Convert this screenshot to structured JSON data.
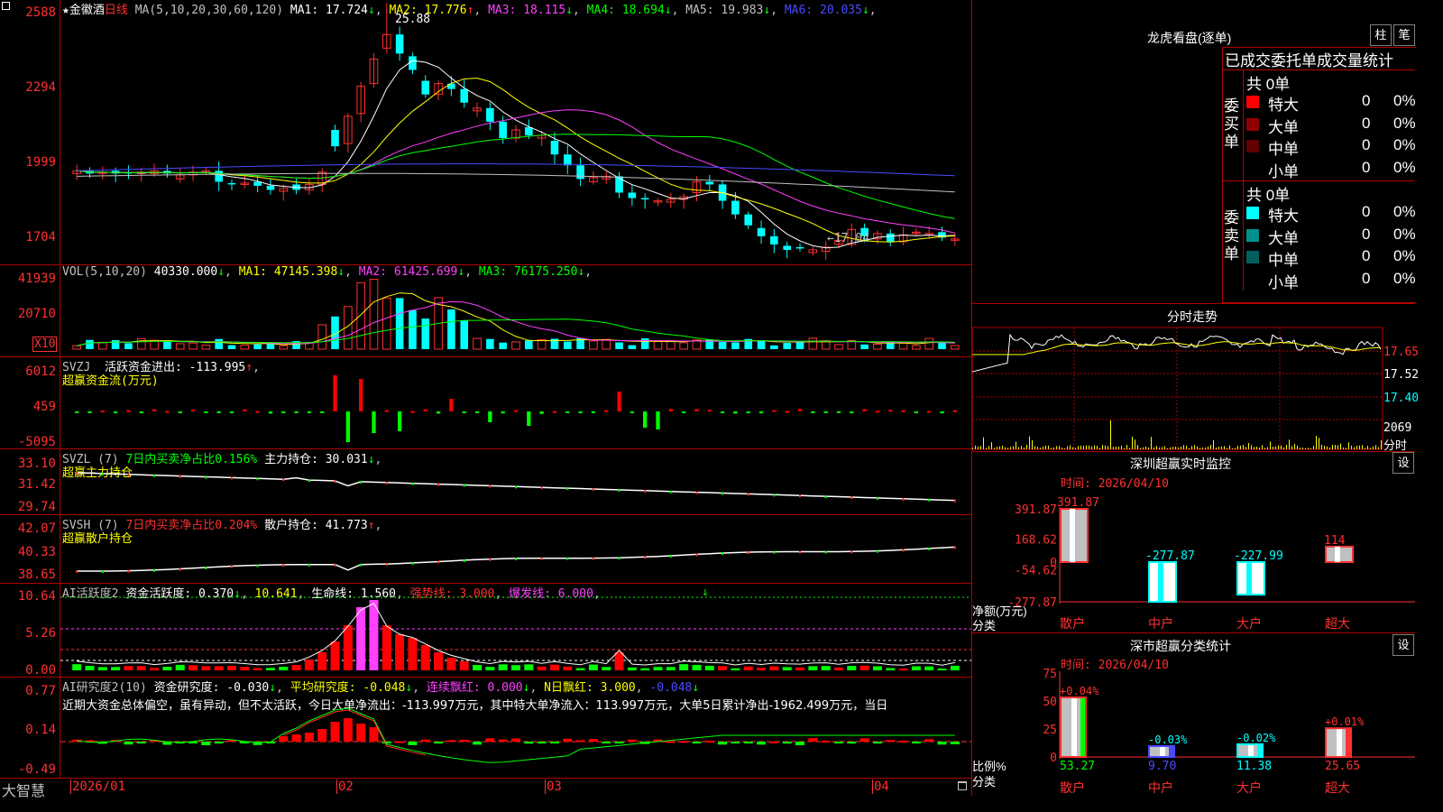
{
  "stock": {
    "name": "金徽酒",
    "period": "日线",
    "star": "★"
  },
  "price_pane": {
    "ma_title": "MA(5,10,20,30,60,120)",
    "ma": [
      {
        "label": "MA1:",
        "value": "17.724",
        "dir": "↓",
        "color": "#ffffff"
      },
      {
        "label": "MA2:",
        "value": "17.776",
        "dir": "↑",
        "color": "#ffff00"
      },
      {
        "label": "MA3:",
        "value": "18.115",
        "dir": "↓",
        "color": "#ff40ff"
      },
      {
        "label": "MA4:",
        "value": "18.694",
        "dir": "↓",
        "color": "#00ff00"
      },
      {
        "label": "MA5:",
        "value": "19.983",
        "dir": "↓",
        "color": "#c0c0c0"
      },
      {
        "label": "MA6:",
        "value": "20.035",
        "dir": "↓",
        "color": "#4a4aff"
      }
    ],
    "y_labels": [
      "2588",
      "2294",
      "1999",
      "1704"
    ],
    "high_label": "25.88",
    "low_label": "←17.04"
  },
  "vol_pane": {
    "title": "VOL(5,10,20)",
    "value": "40330.000",
    "dir": "↓",
    "ma": [
      {
        "label": "MA1:",
        "value": "47145.398",
        "dir": "↓",
        "color": "#ffff00"
      },
      {
        "label": "MA2:",
        "value": "61425.699",
        "dir": "↓",
        "color": "#ff40ff"
      },
      {
        "label": "MA3:",
        "value": "76175.250",
        "dir": "↓",
        "color": "#00ff00"
      }
    ],
    "y_labels": [
      "41939",
      "20710"
    ],
    "unit": "X10"
  },
  "svzj_pane": {
    "title": "SVZJ",
    "label": "活跃资金进出:",
    "value": "-113.995",
    "dir": "↑",
    "sub": "超赢资金流(万元)",
    "y_labels": [
      "6012",
      "459",
      "-5095"
    ]
  },
  "svzl_pane": {
    "title": "SVZL (7)",
    "ratio_label": "7日内买卖净占比0.156%",
    "hold_label": "主力持仓:",
    "hold_value": "30.031",
    "dir": "↓",
    "sub": "超赢主力持仓",
    "y_labels": [
      "33.10",
      "31.42",
      "29.74"
    ]
  },
  "svsh_pane": {
    "title": "SVSH (7)",
    "ratio_label": "7日内买卖净占比0.204%",
    "hold_label": "散户持仓:",
    "hold_value": "41.773",
    "dir": "↑",
    "sub": "超赢散户持仓",
    "y_labels": [
      "42.07",
      "40.33",
      "38.65"
    ]
  },
  "ai_active_pane": {
    "title": "AI活跃度2",
    "label": "资金活跃度:",
    "value": "0.370",
    "dir": "↓",
    "v2": "10.641",
    "life_label": "生命线:",
    "life_value": "1.560",
    "strong": "强势线: 3.000",
    "burst": "爆发线: 6.000",
    "y_labels": [
      "10.64",
      "5.26",
      "0.00"
    ]
  },
  "ai_research_pane": {
    "title": "AI研究度2(10)",
    "label": "资金研究度:",
    "value": "-0.030",
    "dir": "↓",
    "avg": "平均研究度: -0.048",
    "avg_dir": "↓",
    "red": "连续飘红: 0.000",
    "red_dir": "↓",
    "nred": "N日飘红: 3.000",
    "nval": "-0.048",
    "nval_dir": "↓",
    "desc": "近期大资金总体偏空，虽有异动，但不太活跃，今日大单净流出：-113.997万元，其中特大单净流入：113.997万元，大单5日累计净出-1962.499万元，当日",
    "y_labels": [
      "0.77",
      "0.14",
      "-0.49"
    ]
  },
  "bottom_axis": {
    "brand": "大智慧",
    "dates": [
      "2026/01",
      "02",
      "03",
      "04"
    ]
  },
  "dragon": {
    "title": "龙虎看盘(逐单)",
    "btn1": "柱",
    "btn2": "笔",
    "header": "已成交委托单成交量统计",
    "buy_label": "委买单",
    "sell_label": "委卖单",
    "buy_total": "共 0单",
    "sell_total": "共 0单",
    "buy_rows": [
      {
        "name": "特大",
        "v": "0",
        "p": "0%",
        "color": "#ff0000"
      },
      {
        "name": "大单",
        "v": "0",
        "p": "0%",
        "color": "#900000"
      },
      {
        "name": "中单",
        "v": "0",
        "p": "0%",
        "color": "#600000"
      },
      {
        "name": "小单",
        "v": "0",
        "p": "0%",
        "color": "#000000"
      }
    ],
    "sell_rows": [
      {
        "name": "特大",
        "v": "0",
        "p": "0%",
        "color": "#00ffff"
      },
      {
        "name": "大单",
        "v": "0",
        "p": "0%",
        "color": "#009090"
      },
      {
        "name": "中单",
        "v": "0",
        "p": "0%",
        "color": "#006060"
      },
      {
        "name": "小单",
        "v": "0",
        "p": "0%",
        "color": "#000000"
      }
    ]
  },
  "intraday": {
    "title": "分时走势",
    "y_labels": [
      "17.65",
      "17.52",
      "17.40"
    ],
    "vol_label": "2069",
    "vol_unit": "分时"
  },
  "monitor": {
    "title": "深圳超赢实时监控",
    "btn": "设",
    "time": "时间: 2026/04/10",
    "y_labels": [
      "391.87",
      "168.62",
      "0",
      "-54.62",
      "-277.87"
    ],
    "ylabel": "净额(万元)",
    "xlabel": "分类",
    "cats": [
      "散户",
      "中户",
      "大户",
      "超大"
    ],
    "values": [
      391.87,
      -277.87,
      -227.99,
      114
    ],
    "value_labels": [
      "391.87",
      "-277.87",
      "-227.99",
      "114"
    ]
  },
  "classify": {
    "title": "深市超赢分类统计",
    "btn": "设",
    "time": "时间: 2026/04/10",
    "y_labels": [
      "75",
      "50",
      "25",
      "0"
    ],
    "ylabel": "比例%",
    "xlabel": "分类",
    "cats": [
      "散户",
      "中户",
      "大户",
      "超大"
    ],
    "values": [
      53.27,
      9.7,
      11.38,
      25.65
    ],
    "value_labels": [
      "53.27",
      "9.70",
      "11.38",
      "25.65"
    ],
    "change_labels": [
      "+0.04%",
      "-0.03%",
      "-0.02%",
      "+0.01%"
    ]
  }
}
